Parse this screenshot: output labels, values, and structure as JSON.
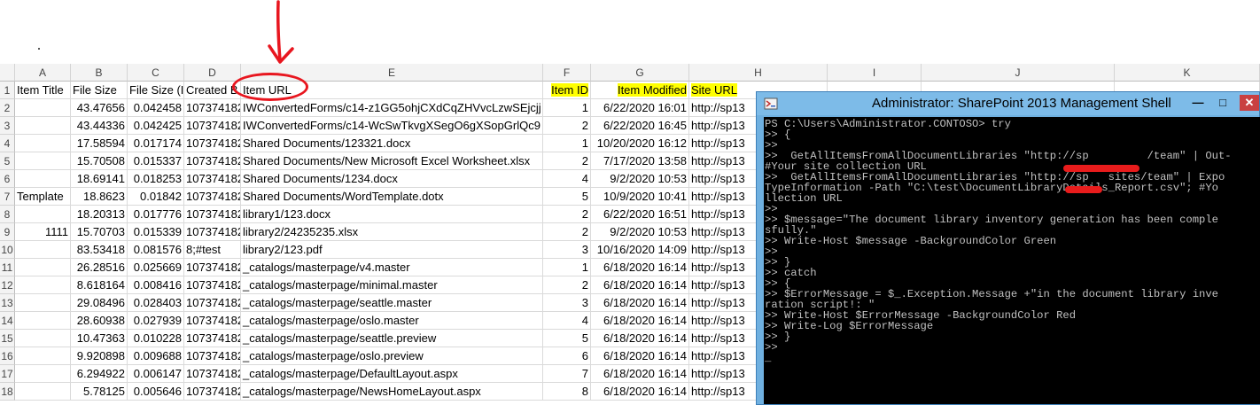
{
  "columns": [
    "A",
    "B",
    "C",
    "D",
    "E",
    "F",
    "G",
    "H",
    "I",
    "J",
    "K"
  ],
  "header_row": [
    "Item Title",
    "File Size",
    "File Size (I",
    "Created B",
    "Item URL",
    "Item ID",
    "Item Modified",
    "Site URL"
  ],
  "rows": [
    [
      "1",
      "",
      "43.47656",
      "0.042458",
      "107374182",
      "IWConvertedForms/c14-z1GG5ohjCXdCqZHVvcLzwSEjcjj",
      "1",
      "6/22/2020 16:01",
      "http://sp13"
    ],
    [
      "2",
      "",
      "43.44336",
      "0.042425",
      "107374182",
      "IWConvertedForms/c14-WcSwTkvgXSegO6gXSopGrlQc9",
      "2",
      "6/22/2020 16:45",
      "http://sp13"
    ],
    [
      "3",
      "",
      "17.58594",
      "0.017174",
      "107374182",
      "Shared Documents/123321.docx",
      "1",
      "10/20/2020 16:12",
      "http://sp13"
    ],
    [
      "4",
      "",
      "15.70508",
      "0.015337",
      "107374182",
      "Shared Documents/New Microsoft Excel Worksheet.xlsx",
      "2",
      "7/17/2020 13:58",
      "http://sp13"
    ],
    [
      "5",
      "",
      "18.69141",
      "0.018253",
      "107374182",
      "Shared Documents/1234.docx",
      "4",
      "9/2/2020 10:53",
      "http://sp13"
    ],
    [
      "6",
      "Template",
      "18.8623",
      "0.01842",
      "107374182",
      "Shared Documents/WordTemplate.dotx",
      "5",
      "10/9/2020 10:41",
      "http://sp13"
    ],
    [
      "7",
      "",
      "18.20313",
      "0.017776",
      "107374182",
      "library1/123.docx",
      "2",
      "6/22/2020 16:51",
      "http://sp13"
    ],
    [
      "8",
      "1111",
      "15.70703",
      "0.015339",
      "107374182",
      "library2/24235235.xlsx",
      "2",
      "9/2/2020 10:53",
      "http://sp13"
    ],
    [
      "9",
      "",
      "83.53418",
      "0.081576",
      "8;#test",
      "library2/123.pdf",
      "3",
      "10/16/2020 14:09",
      "http://sp13"
    ],
    [
      "10",
      "",
      "26.28516",
      "0.025669",
      "107374182",
      "_catalogs/masterpage/v4.master",
      "1",
      "6/18/2020 16:14",
      "http://sp13"
    ],
    [
      "11",
      "",
      "8.618164",
      "0.008416",
      "107374182",
      "_catalogs/masterpage/minimal.master",
      "2",
      "6/18/2020 16:14",
      "http://sp13"
    ],
    [
      "12",
      "",
      "29.08496",
      "0.028403",
      "107374182",
      "_catalogs/masterpage/seattle.master",
      "3",
      "6/18/2020 16:14",
      "http://sp13"
    ],
    [
      "13",
      "",
      "28.60938",
      "0.027939",
      "107374182",
      "_catalogs/masterpage/oslo.master",
      "4",
      "6/18/2020 16:14",
      "http://sp13"
    ],
    [
      "14",
      "",
      "10.47363",
      "0.010228",
      "107374182",
      "_catalogs/masterpage/seattle.preview",
      "5",
      "6/18/2020 16:14",
      "http://sp13"
    ],
    [
      "15",
      "",
      "9.920898",
      "0.009688",
      "107374182",
      "_catalogs/masterpage/oslo.preview",
      "6",
      "6/18/2020 16:14",
      "http://sp13"
    ],
    [
      "16",
      "",
      "6.294922",
      "0.006147",
      "107374182",
      "_catalogs/masterpage/DefaultLayout.aspx",
      "7",
      "6/18/2020 16:14",
      "http://sp13"
    ],
    [
      "17",
      "",
      "5.78125",
      "0.005646",
      "107374182",
      "_catalogs/masterpage/NewsHomeLayout.aspx",
      "8",
      "6/18/2020 16:14",
      "http://sp13"
    ]
  ],
  "row_numbers": [
    "1",
    "2",
    "3",
    "4",
    "5",
    "6",
    "7",
    "8",
    "9",
    "10",
    "11",
    "12",
    "13",
    "14",
    "15",
    "16",
    "17",
    "18"
  ],
  "console": {
    "title": "Administrator: SharePoint 2013 Management Shell",
    "lines": [
      "PS C:\\Users\\Administrator.CONTOSO> try",
      ">> {",
      ">>",
      ">>  GetAllItemsFromAllDocumentLibraries \"http://sp         /team\" | Out-",
      "#Your site collection URL",
      ">>  GetAllItemsFromAllDocumentLibraries \"http://sp   sites/team\" | Expo",
      "TypeInformation -Path \"C:\\test\\DocumentLibraryDetails_Report.csv\"; #Yo",
      "llection URL",
      ">>",
      ">> $message=\"The document library inventory generation has been comple",
      "sfully.\"",
      ">> Write-Host $message -BackgroundColor Green",
      ">>",
      ">> }",
      ">> catch",
      ">> {",
      ">> $ErrorMessage = $_.Exception.Message +\"in the document library inve",
      "ration script!: \"",
      ">> Write-Host $ErrorMessage -BackgroundColor Red",
      ">> Write-Log $ErrorMessage",
      ">> }",
      ">>",
      "_"
    ]
  },
  "colors": {
    "highlight": "#ffff00",
    "annotation": "#e8161f",
    "console_bg": "#000000"
  }
}
